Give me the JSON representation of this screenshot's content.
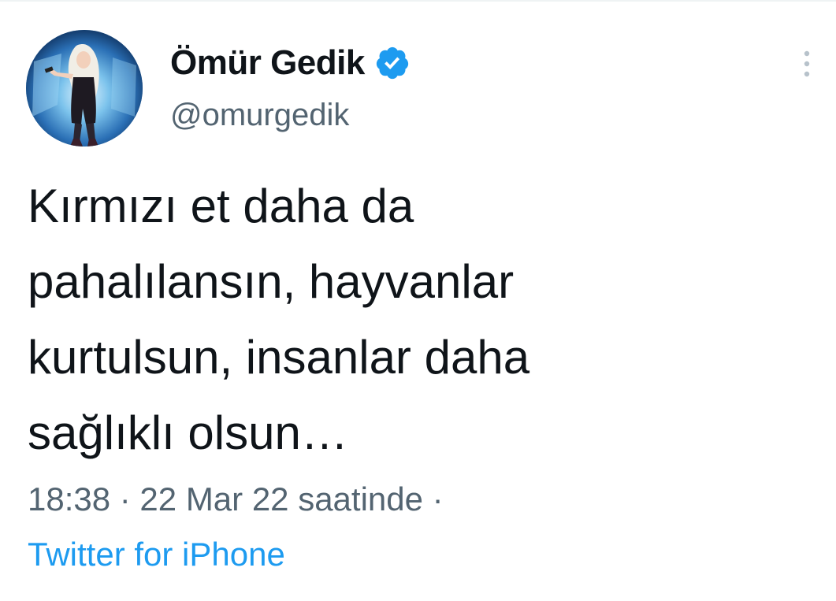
{
  "tweet": {
    "author": {
      "display_name": "Ömür Gedik",
      "username": "@omurgedik",
      "verified": true,
      "avatar_icon": "profile-photo"
    },
    "text_lines": [
      "Kırmızı et daha da",
      "pahalılansın, hayvanlar",
      "kurtulsun, insanlar daha",
      "sağlıklı olsun…"
    ],
    "timestamp": "18:38 · 22 Mar 22 saatinde ·",
    "source": "Twitter for iPhone",
    "more_icon": "more-options-icon"
  },
  "colors": {
    "text_primary": "#0f1419",
    "text_secondary": "#536471",
    "accent": "#1d9bf0"
  }
}
